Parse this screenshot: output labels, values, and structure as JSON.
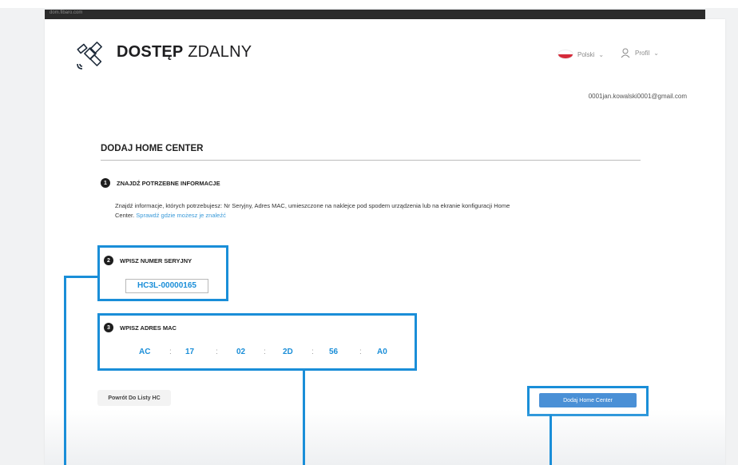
{
  "browser": {
    "strip_text": "dom.fibaro.com"
  },
  "header": {
    "brand_bold": "DOSTĘP",
    "brand_light": "ZDALNY",
    "language": "Polski",
    "profile": "Profil",
    "email": "0001jan.kowalski0001@gmail.com"
  },
  "page": {
    "title": "DODAJ HOME CENTER"
  },
  "steps": [
    {
      "number": "1",
      "label": "ZNAJDŹ POTRZEBNE INFORMACJE"
    },
    {
      "number": "2",
      "label": "WPISZ NUMER SERYJNY"
    },
    {
      "number": "3",
      "label": "WPISZ ADRES MAC"
    }
  ],
  "info": {
    "text_line1": "Znajdź informacje, których potrzebujesz: Nr Seryjny, Adres MAC, umieszczone na naklejce pod spodem urządzenia lub na ekranie konfiguracji Home",
    "text_line2": "Center.",
    "link": "Sprawdź gdzie możesz je znaleźć"
  },
  "serial": {
    "value": "HC3L-00000165"
  },
  "mac": {
    "octets": [
      "AC",
      "17",
      "02",
      "2D",
      "56",
      "A0"
    ],
    "separator": ":"
  },
  "buttons": {
    "back": "Powrót Do Listy HC",
    "add": "Dodaj Home Center"
  },
  "colors": {
    "accent": "#1a8ed8",
    "primary_button": "#4a90d6",
    "flag_red": "#d52b3a"
  }
}
